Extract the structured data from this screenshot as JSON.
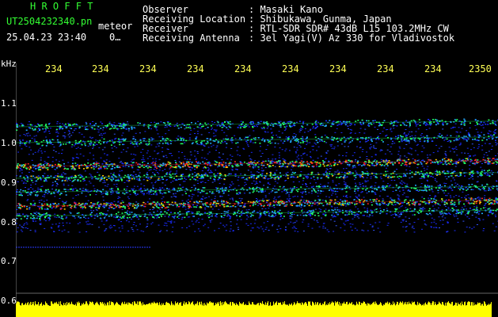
{
  "station": {
    "name": "H R O F F T",
    "filename": "UT2504232340.pn",
    "mode": "meteor",
    "date": "25.04.23 23:40",
    "count": "0…"
  },
  "info": {
    "observer_label": "Observer",
    "observer_value": ": Masaki Kano",
    "location_label": "Receiving Location",
    "location_value": ": Shibukawa, Gunma, Japan",
    "receiver_label": "Receiver",
    "receiver_value": ": RTL-SDR SDR# 43dB L15 103.2MHz CW",
    "antenna_label": "Receiving Antenna",
    "antenna_value": ": 3el Yagi(V) Az 330 for Vladivostok"
  },
  "axis": {
    "unit": "kHz",
    "y_ticks": [
      "1.1",
      "1.0",
      "0.9",
      "0.8",
      "0.7",
      "0.6"
    ],
    "x_ticks": [
      "234",
      "234",
      "234",
      "234",
      "234",
      "234",
      "234",
      "234",
      "234",
      "2350"
    ]
  },
  "colors": {
    "bg": "#000000",
    "noise": "#1a2cff",
    "hot": "#ff2222",
    "mid": "#22ff66",
    "warm": "#ffcc00",
    "audio": "#ffff00",
    "header_green": "#33ff33"
  },
  "bands": [
    {
      "freq": 1.04,
      "intensity": 0.6
    },
    {
      "freq": 1.0,
      "intensity": 0.55
    },
    {
      "freq": 0.94,
      "intensity": 1.0
    },
    {
      "freq": 0.91,
      "intensity": 0.7
    },
    {
      "freq": 0.875,
      "intensity": 0.55
    },
    {
      "freq": 0.84,
      "intensity": 0.95
    },
    {
      "freq": 0.815,
      "intensity": 0.6
    }
  ]
}
